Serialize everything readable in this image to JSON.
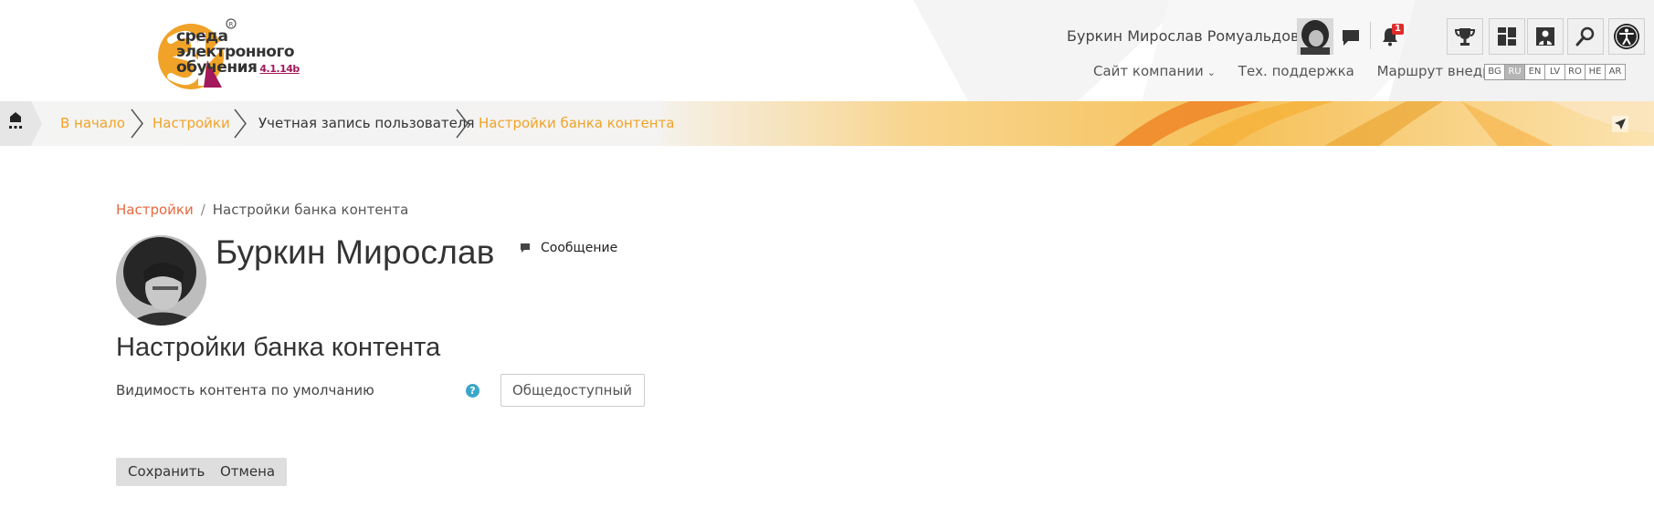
{
  "header": {
    "logo": {
      "lines": [
        "среда",
        "электронного",
        "обучения"
      ],
      "version": "4.1.14b"
    },
    "user_name": "Буркин Мирослав Ромуальдович",
    "notification_count": "1",
    "nav_links": [
      "Сайт компании",
      "Тех. поддержка",
      "Маршрут внедрения"
    ],
    "languages": [
      "BG",
      "RU",
      "EN",
      "LV",
      "RO",
      "HE",
      "AR"
    ],
    "active_language": "RU",
    "icons": [
      "chat-icon",
      "bell-icon",
      "trophy-icon",
      "dashboard-icon",
      "person-board-icon",
      "search-icon",
      "accessibility-icon"
    ]
  },
  "crumb_bar": {
    "items": [
      {
        "label": "В начало",
        "type": "link"
      },
      {
        "label": "Настройки",
        "type": "link"
      },
      {
        "label": "Учетная запись пользователя",
        "type": "plain"
      },
      {
        "label": "Настройки банка контента",
        "type": "link"
      }
    ]
  },
  "page_breadcrumb": {
    "link": "Настройки",
    "separator": "/",
    "current": "Настройки банка контента"
  },
  "profile": {
    "name": "Буркин Мирослав",
    "message_link": "Сообщение"
  },
  "form": {
    "title": "Настройки банка контента",
    "field_label": "Видимость контента по умолчанию",
    "help_icon": "?",
    "select_value": "Общедоступный",
    "save_label": "Сохранить",
    "cancel_label": "Отмена"
  },
  "colors": {
    "accent_orange": "#f0a328",
    "link_orange": "#e8683f",
    "help_blue": "#3aa6c9",
    "badge_red": "#e02b2b",
    "logo_magenta": "#a3195b"
  }
}
